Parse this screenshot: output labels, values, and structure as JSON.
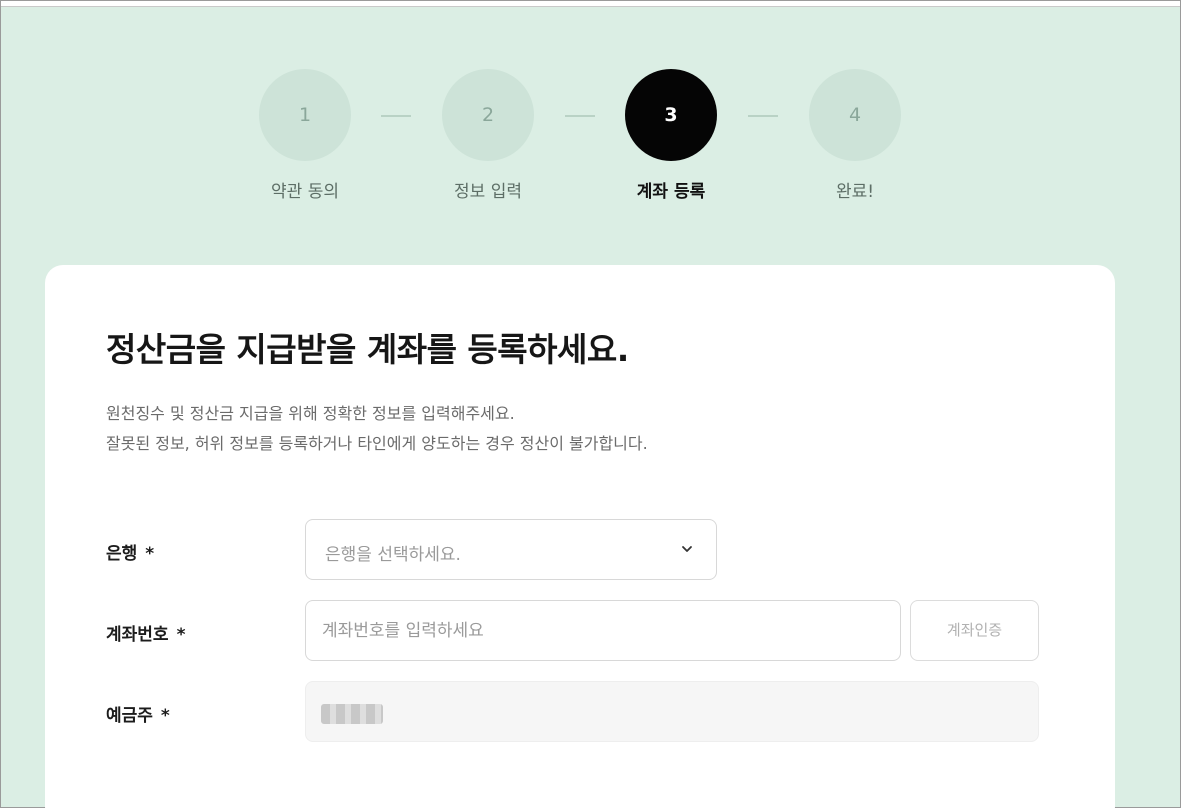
{
  "steps": [
    {
      "number": "1",
      "label": "약관 동의",
      "active": false
    },
    {
      "number": "2",
      "label": "정보 입력",
      "active": false
    },
    {
      "number": "3",
      "label": "계좌 등록",
      "active": true
    },
    {
      "number": "4",
      "label": "완료!",
      "active": false
    }
  ],
  "form": {
    "title": "정산금을 지급받을 계좌를 등록하세요.",
    "description_line1": "원천징수 및 정산금 지급을 위해 정확한 정보를 입력해주세요.",
    "description_line2": "잘못된 정보, 허위 정보를 등록하거나 타인에게 양도하는 경우 정산이 불가합니다.",
    "bank": {
      "label": "은행",
      "required_mark": "*",
      "placeholder": "은행을 선택하세요."
    },
    "account": {
      "label": "계좌번호",
      "required_mark": "*",
      "placeholder": "계좌번호를 입력하세요",
      "verify_button": "계좌인증"
    },
    "holder": {
      "label": "예금주",
      "required_mark": "*"
    }
  },
  "colors": {
    "background": "#dbeee4",
    "step_inactive": "#cde3d8",
    "step_active": "#050505"
  }
}
